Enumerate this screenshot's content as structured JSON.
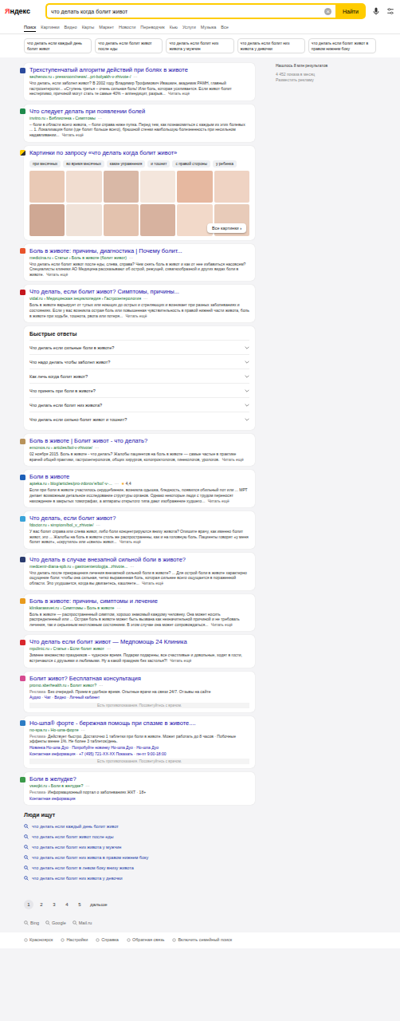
{
  "header": {
    "logo": "Яндекс",
    "query": "что делать когда болит живот",
    "clear": "×",
    "button": "Найти"
  },
  "tabs": [
    {
      "label": "Поиск",
      "selected": true
    },
    {
      "label": "Картинки",
      "selected": false
    },
    {
      "label": "Видео",
      "selected": false
    },
    {
      "label": "Карты",
      "selected": false
    },
    {
      "label": "Маркет",
      "selected": false
    },
    {
      "label": "Новости",
      "selected": false
    },
    {
      "label": "Переводчик",
      "selected": false
    },
    {
      "label": "Кью",
      "selected": false
    },
    {
      "label": "Услуги",
      "selected": false
    },
    {
      "label": "Музыка",
      "selected": false
    },
    {
      "label": "Все",
      "selected": false
    }
  ],
  "suggestions": [
    "что делать если каждый день болит живот",
    "что делать если болит живот после еды",
    "что делать если болит низ живота у мужчин",
    "что делать если болит низ живота у девочки",
    "что делать если болит живот в правом нижнем боку"
  ],
  "sidebar": {
    "found": "Нашлось 8 млн результатов",
    "shows": "4 452 показа в месяц",
    "advertise": "Разместить рекламу"
  },
  "menuDots": "···",
  "blocks": [
    {
      "kind": "organic",
      "color": "#2b4a9c",
      "title": "Трехступенчатый алгоритм действий при болях в животе",
      "url": "sechenov.ru › pressroom/news/...pri-bolyakh-v-zhivote-/",
      "snippet": "Что делать, если заболел живот? В 2002 году Владимир Трофимович Ивашкин, академик РАМН, главный гастроэнтеролог... «Ступень третья – очень сильная боль! Или боль, которая усиливается. Если живот болит нестерпимо, причиной могут стать те самые 40% – аппендицит, разрыв...",
      "more": "Читать ещё"
    },
    {
      "kind": "organic",
      "color": "#1f8a4c",
      "title": "Что следует делать при появлении болей",
      "url": "invitro.ru › Библиотека › Симптомы",
      "snippet": "– боли в области всего живота, – боли справа ниже пупка. Перед тем, как познакомиться с каждым из этих болевых ... 1. Локализация боли (где болит больше всего), брюшной стенки наибольшую болезненность при несильном надавливании...",
      "more": "Читать ещё"
    },
    {
      "kind": "images",
      "title": "Картинки по запросу «что делать когда болит живот»",
      "chips": [
        "при месячных",
        "во время месячных",
        "какие упражнения",
        "и тошнит",
        "с правой стороны",
        "у ребенка"
      ],
      "button": "Все картинки",
      "next": "›"
    },
    {
      "kind": "organic",
      "color": "#e8532b",
      "title": "Боль в животе: причины, диагностика | Почему болит...",
      "url": "medicina.ru › Статьи › Боль в животе (болит живот)",
      "snippet": "Что делать если болит живот после еды, слева, справа? Чем снять боль в живот и как от нее избавиться насовсем? Специалисты клиники АО Медицина рассказывают об острой, режущей, схваткообразной и других видах боли в животе.",
      "more": "Читать ещё"
    },
    {
      "kind": "organic",
      "color": "#c4161c",
      "title": "Что делать, если болит живот? Симптомы, причины...",
      "url": "vidal.ru › Медицинская энциклопедия › Гастроэнтерология",
      "snippet": "Боль в животе варьирует от тупых или ноющих до острых и стреляющих и возникает при разных заболеваниях и состояниях. Если у вас возникла острая боль или повышенная чувствительность в правой нижней части живота, боль в животе при ходьбе, тошнота, рвота или потеря...",
      "more": "Читать ещё"
    },
    {
      "kind": "quick",
      "title": "Быстрые ответы",
      "items": [
        "Что делать если сильные боли в животе?",
        "Что надо делать чтобы заболел живот?",
        "Как лечь когда болит живот?",
        "Что принять при боли в животе?",
        "Что делать если болит низ живота?",
        "Что делать если сильно болит живот и тошнит?"
      ]
    },
    {
      "kind": "organic",
      "color": "#b8925a",
      "title": "Боль в животе | Болит живот - что делать?",
      "url": "emcmos.ru › articles/bol-v-zhivote/",
      "snippet": "02 ноября 2015. Боль в животе - что делать? Жалобы пациентов на боль в животе — самые частые в практике врачей общей практики, гастроэнтерологов, общих хирургов, колопроктологов, гинекологов, урологов.",
      "more": "Читать ещё"
    },
    {
      "kind": "organic",
      "color": "#1d5fb8",
      "title": "Боли в животе",
      "url": "apteka.ru › blog/articles/pro-zdorov'e/bol'-v-...",
      "star": "★",
      "rating": "4,4",
      "snippet": "Если при боли в животе участилось сердцебиение, возникла одышка, бледность, появился обильный пот или ... МРТ делает возможным детальное исследование структуры органов. Однако некоторые люди с трудом переносят нахождение в закрытых томографах, а аппараты открытого типа дают изображение худшего...",
      "more": "Читать ещё"
    },
    {
      "kind": "organic",
      "color": "#3aa3d8",
      "title": "Что делать, если болит живот?",
      "url": "fdoctor.ru › simptom/bol_v_zhivote/",
      "snippet": "У вас болит справа или слева живот, либо боли концентрируются внизу живота? Опишите врачу, как именно болит живот, это ... Жалобы на боль в животе столь же распространены, как и на головную боль. Пациенты говорят «у меня болит живот», «скрутило» или «свело» живот...",
      "more": "Читать ещё"
    },
    {
      "kind": "organic",
      "color": "#2a3b6e",
      "title": "Что делать в случае внезапной сильной боли в животе?",
      "url": "medcentr-diana-spb.ru › gastroenterologija...zhivote...",
      "snippet": "Что делать после прекращения лечения внезапной сильной боли в животе? ... Для острой боли в животе характерно ощущение боли: чтобы она сильная, четко выраженная боль, которая сильнее всего ощущается в пораженной области. Это ухудшается, когда вы двигаетесь, кашляете...",
      "more": "Читать ещё"
    },
    {
      "kind": "organic",
      "color": "#e89a1c",
      "title": "Боль в животе: причины, симптомы и лечение",
      "url": "klinikarassvet.ru › Симптомы › Боль в животе",
      "snippet": "Боль в животе — распространенный симптом, хорошо знакомый каждому человеку. Она может носить распределенный или ... Острая боль в животе может быть вызвана как незначительной причиной и не требовать лечения, так и серьезным неотложным состоянием. В этом случае она может сопровождаться...",
      "more": "Читать ещё"
    },
    {
      "kind": "organic",
      "color": "#d8262c",
      "title": "Что делать если болит живот — Медпомощь 24 Клиника",
      "url": "mpclinic.ru › Статьи › Если болит живот",
      "snippet": "Зимнее множество праздников – чудесное время. Подарки подарены, все счастливые и довольные, ходят в гости, встречаются с друзьями и любимыми. Ну а какой праздник без застолья?!",
      "more": "Читать ещё"
    },
    {
      "kind": "ad",
      "color": "#d64a8f",
      "title": "Болит живот? Бесплатная консультация",
      "url": "promo.sberhealth.ru › Болит живот?",
      "label": "Реклама",
      "snippet": "· Без очередей. Прием в удобное время. Опытные врачи на связи 24/7. Отзывы на сайте",
      "links": "Аудио · Чат · Видео · Личный кабинет",
      "contact": "",
      "warning": "Есть противопоказания. Посоветуйтесь с врачом."
    },
    {
      "kind": "ad",
      "color": "#2c7cc4",
      "title": "Но-шпа® форте - бережная помощь при спазме в животе....",
      "url": "no-spa.ru › Но-шпа-форте",
      "label": "Реклама",
      "snippet": "· Действует быстро. Достаточно 1 таблетки при боли в животе. Может работать до 8 часов · Побочные эффекты менее 1%. Не более 3 таблеток/день.",
      "links": "Новинка Но-шпа Дуо · Попробуйте новинку Но-шпа Дуо · Но-шпа Дуо",
      "contact": "Контактная информация · +7 (495) 721-XX-XX Показать · пн-пт 9:00-18:00",
      "warning": "Есть противопоказания. Посоветуйтесь с врачом."
    },
    {
      "kind": "ad",
      "color": "#3b9a4a",
      "title": "Боли в желудке?",
      "url": "vseojkt.ru › Боли в желудке?",
      "label": "Реклама",
      "snippet": "· Информационный портал о заболеваниях ЖКТ · 18+",
      "links": "",
      "contact": "Контактная информация",
      "warning": ""
    },
    {
      "kind": "people",
      "title": "Люди ищут",
      "items": [
        "что делать если каждый день болит живот",
        "что делать если болит живот после еды",
        "что делать если болит низ живота у мужчин",
        "что делать если болит низ живота в правом нижнем боку",
        "что делать если болит в левом боку внизу живота",
        "что делать если болит низ живота у девочки"
      ]
    }
  ],
  "pagination": {
    "pages": [
      {
        "label": "1",
        "selected": true
      },
      {
        "label": "2",
        "selected": false
      },
      {
        "label": "3",
        "selected": false
      },
      {
        "label": "4",
        "selected": false
      },
      {
        "label": "5",
        "selected": false
      }
    ],
    "next": "дальше"
  },
  "engines": [
    "Bing",
    "Google",
    "Mail.ru"
  ],
  "footer": [
    "Красноярск",
    "Настройки",
    "Справка",
    "Обратная связь",
    "Включить семейный поиск"
  ]
}
